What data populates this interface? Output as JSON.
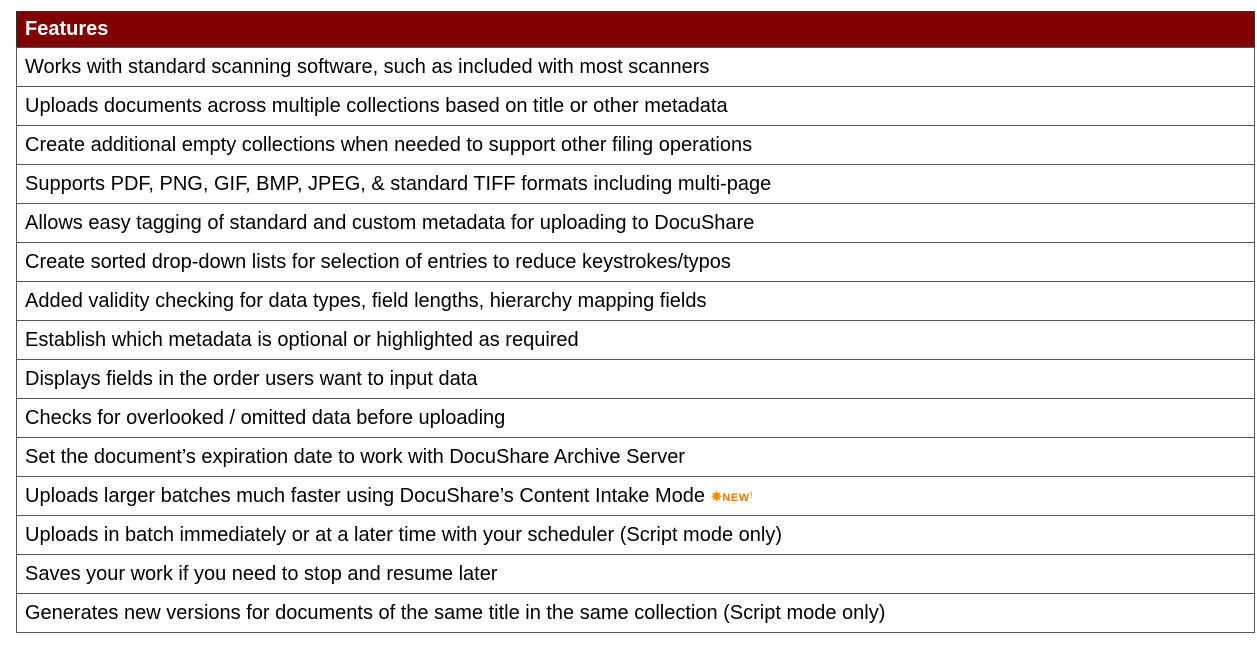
{
  "table": {
    "header": "Features",
    "rows": [
      "Works with standard scanning software, such as included with most scanners",
      "Uploads documents across multiple collections based on title or other metadata",
      "Create additional empty collections when needed to support other filing operations",
      "Supports PDF, PNG, GIF, BMP, JPEG, & standard TIFF formats including multi-page",
      "Allows easy tagging of standard and custom metadata for uploading to DocuShare",
      "Create sorted drop-down lists for selection of entries to reduce keystrokes/typos",
      "Added validity checking for data types, field lengths, hierarchy mapping fields",
      "Establish which metadata is optional or highlighted as required",
      "Displays fields in the order users want to input data",
      "Checks for overlooked / omitted data before uploading",
      "Set the document’s expiration date to work with DocuShare Archive Server",
      "Uploads larger batches much faster using DocuShare’s Content Intake Mode",
      "Uploads in batch immediately or at a later time with your scheduler (Script mode only)",
      "Saves your work if you need to stop and resume later",
      "Generates new versions for documents of the same title in the same collection (Script mode only)"
    ],
    "new_badge": {
      "text": "NEW",
      "row_index": 11,
      "icon": "new-star-icon"
    }
  },
  "colors": {
    "header_background": "#800000",
    "header_text": "#ffffff",
    "border": "#555555",
    "badge": "#f07800"
  }
}
